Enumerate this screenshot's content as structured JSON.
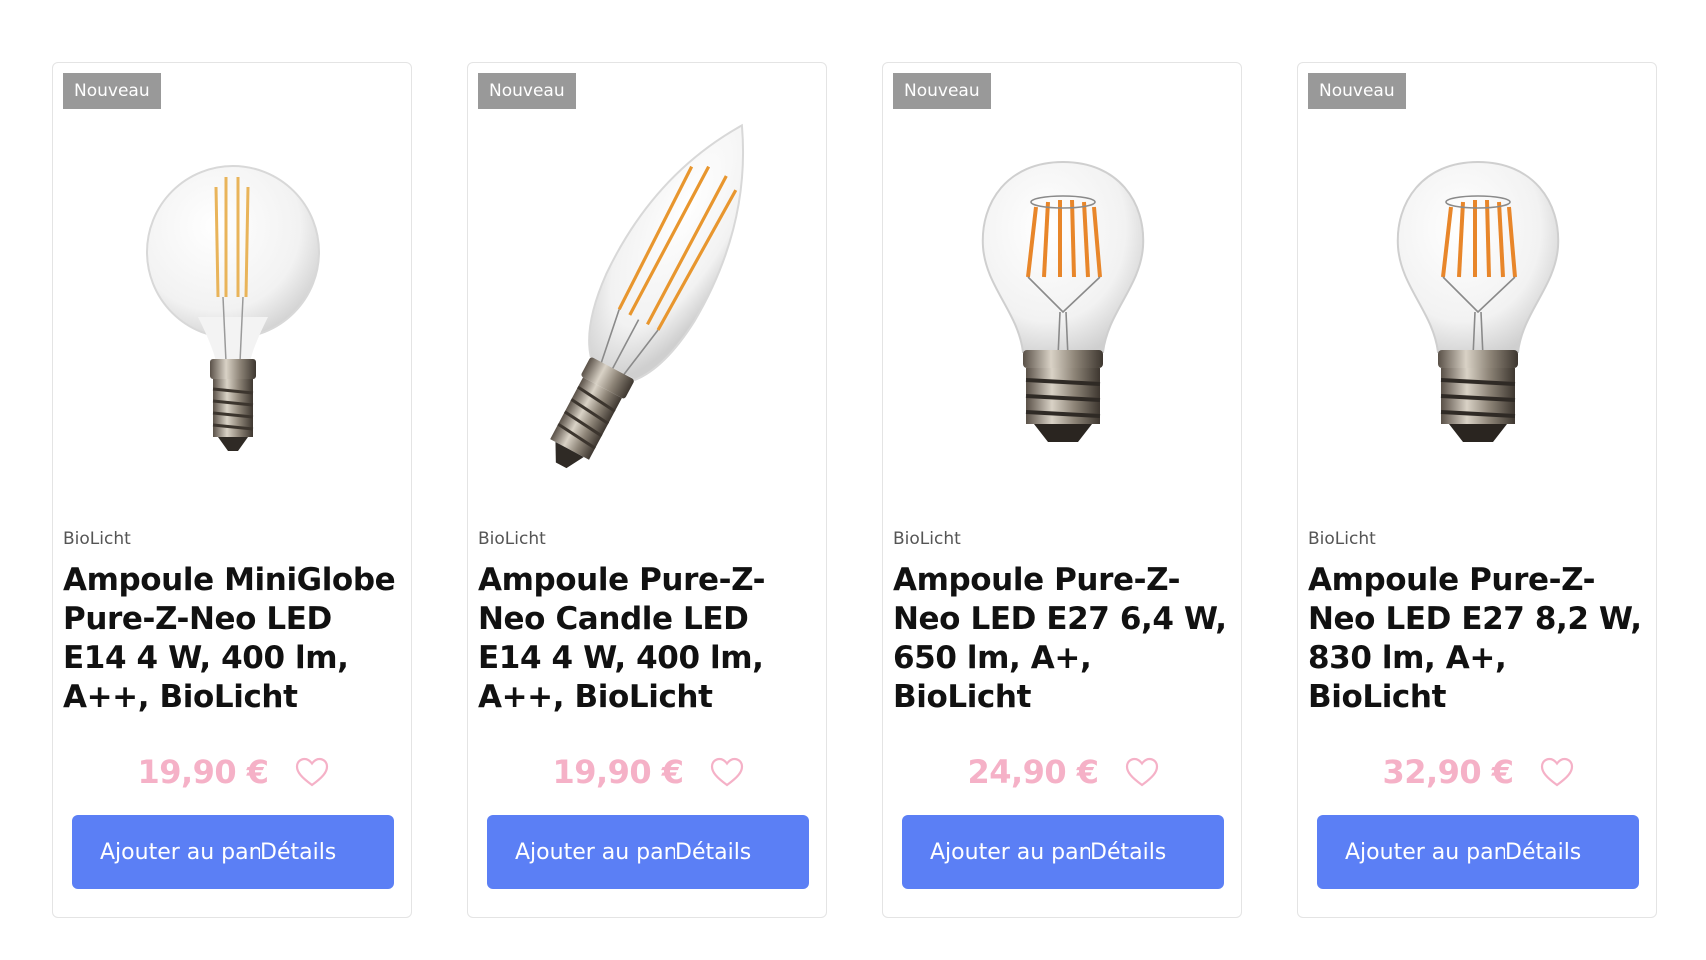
{
  "products": [
    {
      "badge": "Nouveau",
      "image_icon": "globe-bulb-e14",
      "brand": "BioLicht",
      "title": "Ampoule MiniGlobe Pure-Z-Neo LED E14 4 W, 400 lm, A++, BioLicht",
      "price": "19,90 €",
      "add_label": "Ajouter au panier",
      "details_label": "Détails"
    },
    {
      "badge": "Nouveau",
      "image_icon": "candle-bulb-e14",
      "brand": "BioLicht",
      "title": "Ampoule Pure-Z-Neo Candle LED E14 4 W, 400 lm, A++, BioLicht",
      "price": "19,90 €",
      "add_label": "Ajouter au panier",
      "details_label": "Détails"
    },
    {
      "badge": "Nouveau",
      "image_icon": "standard-bulb-e27",
      "brand": "BioLicht",
      "title": "Ampoule Pure-Z-Neo LED E27 6,4 W, 650 lm, A+, BioLicht",
      "price": "24,90 €",
      "add_label": "Ajouter au panier",
      "details_label": "Détails"
    },
    {
      "badge": "Nouveau",
      "image_icon": "standard-bulb-e27",
      "brand": "BioLicht",
      "title": "Ampoule Pure-Z-Neo LED E27 8,2 W, 830 lm, A+, BioLicht",
      "price": "32,90 €",
      "add_label": "Ajouter au panier",
      "details_label": "Détails"
    }
  ],
  "colors": {
    "badge_bg": "#999999",
    "price": "#f5b1c7",
    "button_bg": "#5b7ff5",
    "filament": "#e8962e"
  }
}
